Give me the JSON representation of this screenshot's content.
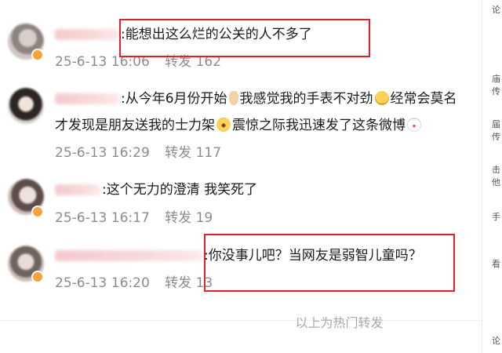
{
  "comments": [
    {
      "name_redacted": "",
      "text": ":能想出这么烂的公关的人不多了",
      "date": "25-6-13",
      "time": "16:06",
      "repost_label": "转发",
      "repost_count": "162"
    },
    {
      "name_redacted": "",
      "text_line1_a": ":从今年6月份开始",
      "text_line1_b": "我感觉我的手表不对劲",
      "text_line1_c": "经常会莫名",
      "text_line2_a": "才发现是朋友送我的士力架",
      "text_line2_b": "震惊之际我迅速发了这条微博",
      "date": "25-6-13",
      "time": "16:29",
      "repost_label": "转发",
      "repost_count": "117"
    },
    {
      "name_redacted": "",
      "text": ":这个无力的澄清 我笑死了",
      "date": "25-6-13",
      "time": "16:17",
      "repost_label": "转发",
      "repost_count": "19"
    },
    {
      "name_redacted": "",
      "text": ":你没事儿吧？当网友是弱智儿童吗？",
      "date": "25-6-13",
      "time": "16:20",
      "repost_label": "转发",
      "repost_count": "13"
    }
  ],
  "footer_note": "以上为热门转发",
  "side_rail": [
    "论",
    "庙",
    "传",
    "届",
    "传",
    "击",
    "他",
    "手",
    "看",
    "论"
  ],
  "colors": {
    "highlight": "#e0202a",
    "meta_text": "#8c8c8c",
    "footer_text": "#a9a9a9",
    "badge": "#f5a23c"
  },
  "icons": [
    "hand-emoji-icon",
    "angry-emoji-icon",
    "shocked-emoji-icon",
    "clown-emoji-icon",
    "vip-badge-icon"
  ]
}
